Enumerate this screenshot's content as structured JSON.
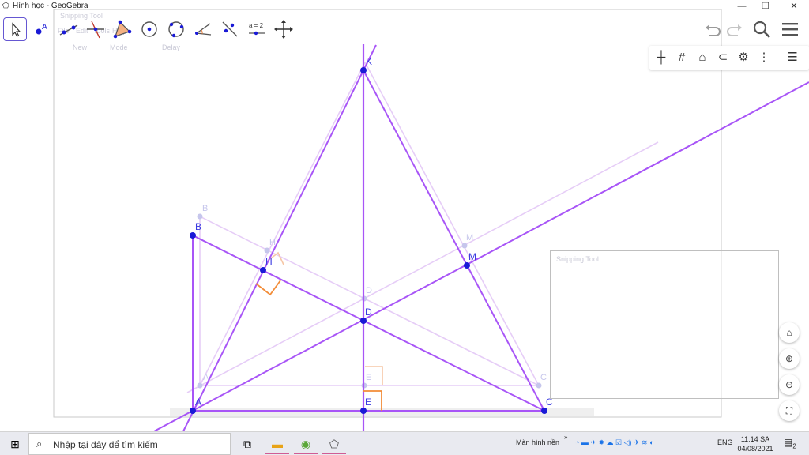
{
  "window": {
    "title": "Hình học - GeoGebra"
  },
  "ghost_window": {
    "title": "Snipping Tool",
    "menu": [
      "File",
      "Edit",
      "Tools",
      "Help"
    ],
    "buttons": [
      "New",
      "Mode",
      "Delay"
    ]
  },
  "snipping_tool_title": "Snipping Tool",
  "points": {
    "K": "K",
    "B": "B",
    "H": "H",
    "M": "M",
    "D": "D",
    "A": "A",
    "E": "E",
    "C": "C"
  },
  "ghost_points": {
    "B": "B",
    "H": "H",
    "M": "M",
    "D": "D",
    "E": "E",
    "C": "C",
    "A": "A"
  },
  "tools": {
    "text_tool_label": "a = 2"
  },
  "taskbar": {
    "search_placeholder": "Nhập tại đây để tìm kiếm",
    "desktop_label": "Màn hình nền",
    "language": "ENG",
    "time": "11:14 SA",
    "date": "04/08/2021",
    "notification_count": "2"
  },
  "colors": {
    "line": "#a855f7",
    "line_dark": "#9d4edd",
    "point": "#1a1ad6",
    "right_angle": "#f28c38",
    "accent": "#6557d2"
  }
}
